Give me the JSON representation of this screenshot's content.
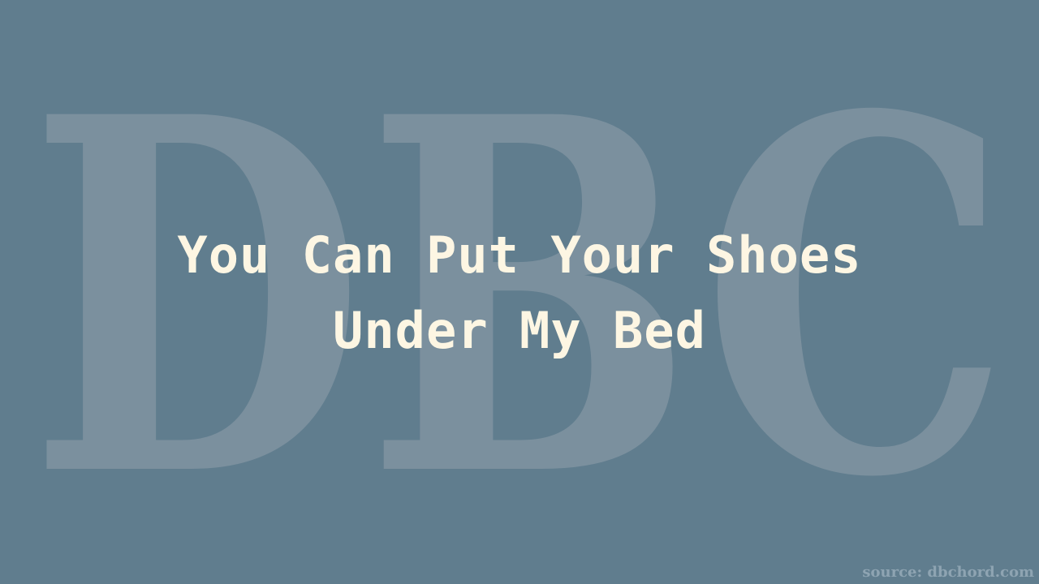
{
  "watermark": {
    "text": "DBC",
    "color": "#7b909e"
  },
  "title": {
    "line1": "You Can Put Your Shoes",
    "line2": "Under My Bed",
    "color": "#fdf6e3"
  },
  "footer": {
    "source": "source: dbchord.com"
  },
  "background": "#607d8e"
}
